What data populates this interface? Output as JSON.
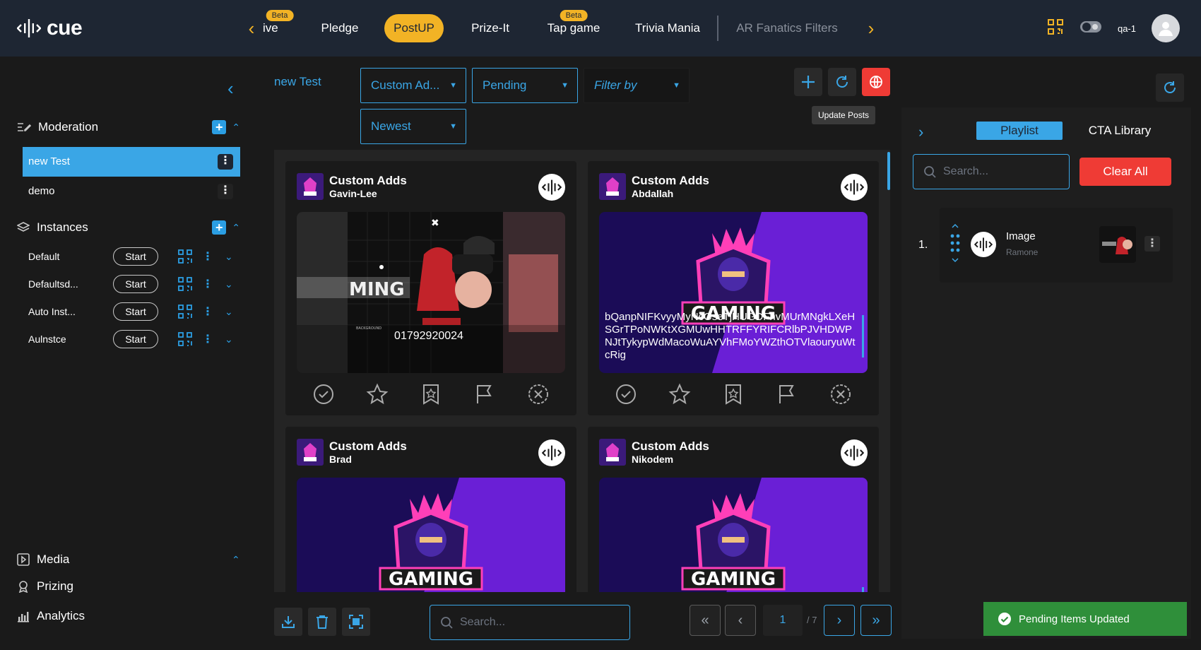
{
  "brand": {
    "logo_text": "cue"
  },
  "topnav": {
    "tabs": [
      {
        "label": "ive",
        "beta": "Beta"
      },
      {
        "label": "Pledge"
      },
      {
        "label": "PostUP"
      },
      {
        "label": "Prize-It"
      },
      {
        "label": "Tap game",
        "beta": "Beta"
      },
      {
        "label": "Trivia Mania"
      },
      {
        "label": "AR Fanatics Filters"
      }
    ],
    "active_tab": "PostUP",
    "user": "qa-1"
  },
  "sidebar": {
    "moderation": {
      "title": "Moderation",
      "items": [
        {
          "label": "new Test"
        },
        {
          "label": "demo"
        }
      ]
    },
    "instances": {
      "title": "Instances",
      "start_label": "Start",
      "items": [
        {
          "label": "Default"
        },
        {
          "label": "Defaultsd..."
        },
        {
          "label": "Auto Inst..."
        },
        {
          "label": "Aulnstce"
        }
      ]
    },
    "bottom": {
      "media": "Media",
      "prizing": "Prizing",
      "analytics": "Analytics"
    }
  },
  "main": {
    "breadcrumb": "new Test",
    "filters": {
      "source": "Custom Ad...",
      "status": "Pending",
      "filter_by": "Filter by",
      "sort": "Newest"
    },
    "tooltip": "Update Posts",
    "cards": [
      {
        "title": "Custom Adds",
        "user": "Gavin-Lee",
        "media_text": "01792920024"
      },
      {
        "title": "Custom Adds",
        "user": "Abdallah",
        "media_text": "bQanpNIFKvyyMyNcGseTjHUGDFhvMUrMNgkLXeHSGrTPoNWKtXGMUwHHTRFFYRIFCRlbPJVHDWPNJtTykypWdMacoWuAYVhFMoYWZthOTVlaouryuWtcRig"
      },
      {
        "title": "Custom Adds",
        "user": "Brad",
        "media_text": ""
      },
      {
        "title": "Custom Adds",
        "user": "Nikodem",
        "media_text": ""
      }
    ],
    "logo_word": "GAMING",
    "search_placeholder": "Search...",
    "pagination": {
      "current": "1",
      "total": "/ 7"
    }
  },
  "playlist": {
    "tabs": {
      "playlist": "Playlist",
      "cta": "CTA Library"
    },
    "search_placeholder": "Search...",
    "clear_all": "Clear All",
    "items": [
      {
        "index": "1.",
        "title": "Image",
        "subtitle": "Ramone"
      }
    ]
  },
  "toast": "Pending Items Updated",
  "colors": {
    "accent": "#3aa6e6",
    "yellow": "#f2b325",
    "danger": "#ef3b35",
    "success": "#2f8f3a"
  }
}
